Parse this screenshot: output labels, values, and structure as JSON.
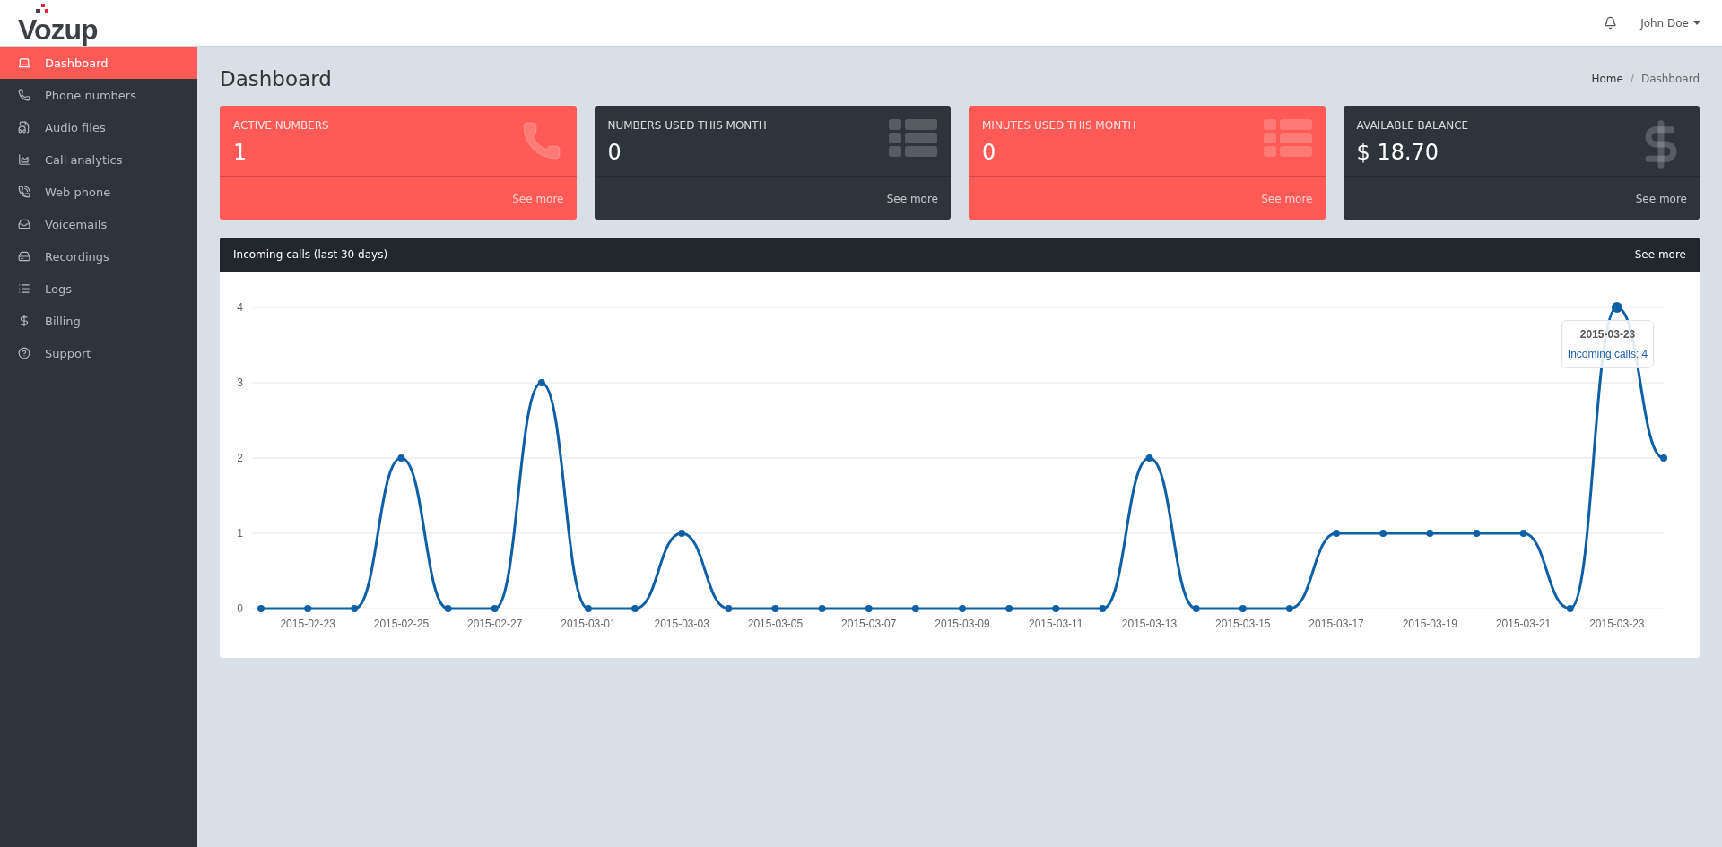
{
  "header": {
    "logo": "Vozup",
    "user": "John Doe"
  },
  "sidebar": {
    "items": [
      {
        "label": "Dashboard",
        "selected": true
      },
      {
        "label": "Phone numbers",
        "selected": false
      },
      {
        "label": "Audio files",
        "selected": false
      },
      {
        "label": "Call analytics",
        "selected": false
      },
      {
        "label": "Web phone",
        "selected": false
      },
      {
        "label": "Voicemails",
        "selected": false
      },
      {
        "label": "Recordings",
        "selected": false
      },
      {
        "label": "Logs",
        "selected": false
      },
      {
        "label": "Billing",
        "selected": false
      },
      {
        "label": "Support",
        "selected": false
      }
    ]
  },
  "page": {
    "title": "Dashboard",
    "breadcrumb": [
      {
        "label": "Home",
        "kind": "link"
      },
      {
        "label": "/",
        "kind": "separator"
      },
      {
        "label": "Dashboard",
        "kind": "current"
      }
    ]
  },
  "cards": [
    {
      "title": "ACTIVE NUMBERS",
      "value": "1",
      "link": "See more",
      "color": "#ff5a56"
    },
    {
      "title": "NUMBERS USED THIS MONTH",
      "value": "0",
      "link": "See more",
      "color": "#2e343c"
    },
    {
      "title": "MINUTES USED THIS MONTH",
      "value": "0",
      "link": "See more",
      "color": "#ff5a56"
    },
    {
      "title": "AVAILABLE BALANCE",
      "value": "$ 18.70",
      "link": "See more",
      "color": "#2e343c"
    }
  ],
  "chart_panel": {
    "title": "Incoming calls (last 30 days)",
    "link": "See more",
    "tooltip": {
      "title": "2015-03-23",
      "separator": ": ",
      "value": "4"
    },
    "chart_data": {
      "type": "line",
      "categories": [
        null,
        "2015-02-23",
        null,
        "2015-02-25",
        null,
        "2015-02-27",
        null,
        "2015-03-01",
        null,
        "2015-03-03",
        null,
        "2015-03-05",
        null,
        "2015-03-07",
        null,
        "2015-03-09",
        null,
        "2015-03-11",
        null,
        "2015-03-13",
        null,
        "2015-03-15",
        null,
        "2015-03-17",
        null,
        "2015-03-19",
        null,
        "2015-03-21",
        null,
        "2015-03-23",
        null
      ],
      "series": [
        {
          "name": "Incoming calls",
          "color": "#0d5fa6",
          "marker": true,
          "values": [
            0,
            0,
            0,
            2,
            0,
            0,
            3,
            0,
            0,
            1,
            0,
            0,
            0,
            0,
            0,
            0,
            0,
            0,
            0,
            2,
            0,
            0,
            0,
            1,
            1,
            1,
            1,
            1,
            0,
            4,
            2
          ]
        }
      ],
      "grid": true,
      "ylim": [
        0,
        4
      ],
      "yticks": [
        {
          "value": 0,
          "label": "0"
        },
        {
          "value": 1,
          "label": "1"
        },
        {
          "value": 2,
          "label": "2"
        },
        {
          "value": 3,
          "label": "3"
        },
        {
          "value": 4,
          "label": "4"
        }
      ]
    }
  }
}
